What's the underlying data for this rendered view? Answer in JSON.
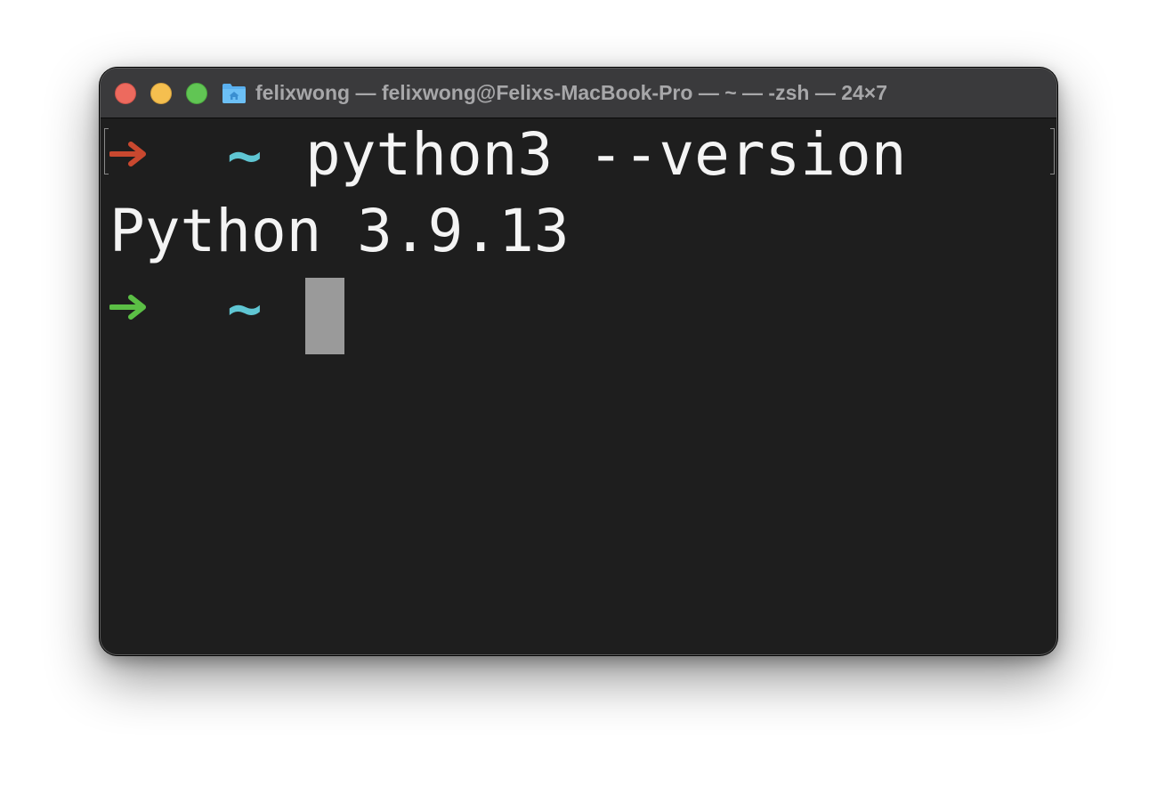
{
  "window": {
    "title": "felixwong — felixwong@Felixs-MacBook-Pro — ~ — -zsh — 24×7",
    "folder_icon": "home-folder-icon",
    "traffic_lights": {
      "close": "#ed6a5e",
      "minimize": "#f5bf4f",
      "maximize": "#61c554"
    }
  },
  "terminal": {
    "background": "#1e1e1e",
    "lines": [
      {
        "prompt_arrow_color": "#c9482f",
        "prompt_dir": "~",
        "command": "python3 --version"
      },
      {
        "output": "Python 3.9.13"
      },
      {
        "prompt_arrow_color": "#5bbf45",
        "prompt_dir": "~",
        "command": ""
      }
    ],
    "colors": {
      "tilde": "#5fc6d3",
      "text": "#f4f4f4",
      "cursor": "#9a9a9a"
    }
  }
}
